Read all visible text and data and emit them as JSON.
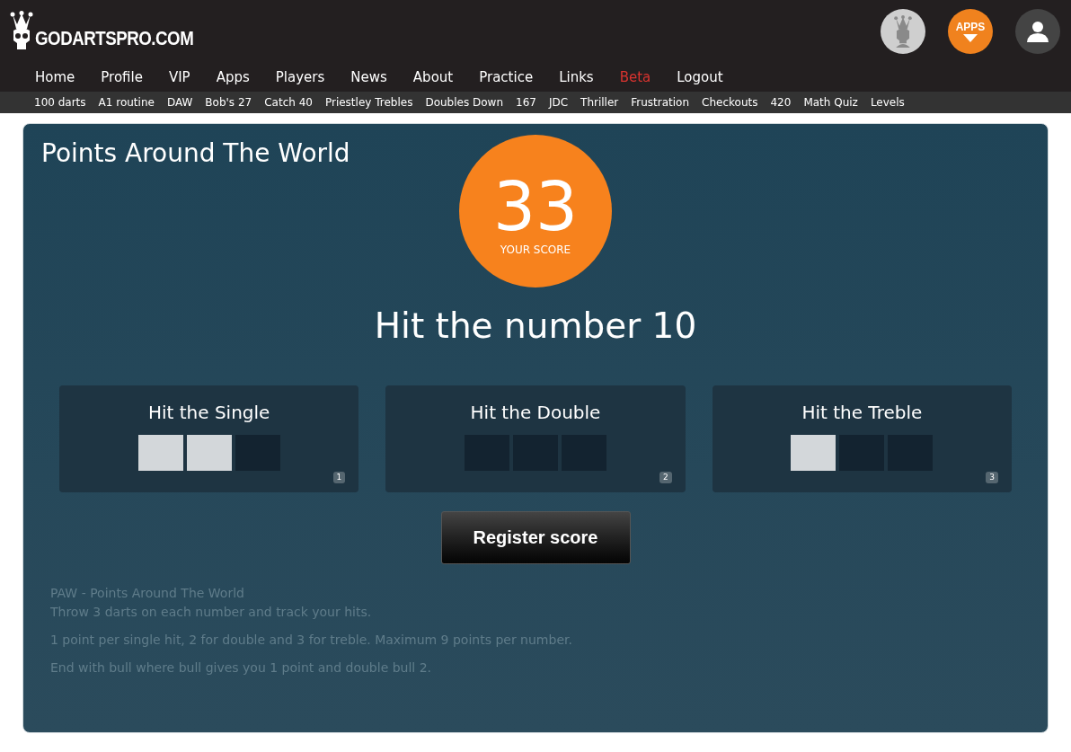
{
  "logo": {
    "text": "GODARTSPRO.COM"
  },
  "header_icons": {
    "apps_label": "APPS"
  },
  "nav": [
    {
      "label": "Home",
      "highlighted": false
    },
    {
      "label": "Profile",
      "highlighted": false
    },
    {
      "label": "VIP",
      "highlighted": false
    },
    {
      "label": "Apps",
      "highlighted": false
    },
    {
      "label": "Players",
      "highlighted": false
    },
    {
      "label": "News",
      "highlighted": false
    },
    {
      "label": "About",
      "highlighted": false
    },
    {
      "label": "Practice",
      "highlighted": false
    },
    {
      "label": "Links",
      "highlighted": false
    },
    {
      "label": "Beta",
      "highlighted": true
    },
    {
      "label": "Logout",
      "highlighted": false
    }
  ],
  "subnav": [
    "100 darts",
    "A1 routine",
    "DAW",
    "Bob's 27",
    "Catch 40",
    "Priestley Trebles",
    "Doubles Down",
    "167",
    "JDC",
    "Thriller",
    "Frustration",
    "Checkouts",
    "420",
    "Math Quiz",
    "Levels"
  ],
  "game": {
    "title": "Points Around The World",
    "score": "33",
    "score_label": "YOUR SCORE",
    "instruction": "Hit the number 10",
    "targets": [
      {
        "title": "Hit the Single",
        "key": "1",
        "darts": [
          {
            "hit": true
          },
          {
            "hit": true
          },
          {
            "hit": false
          }
        ]
      },
      {
        "title": "Hit the Double",
        "key": "2",
        "darts": [
          {
            "hit": false
          },
          {
            "hit": false
          },
          {
            "hit": false
          }
        ]
      },
      {
        "title": "Hit the Treble",
        "key": "3",
        "darts": [
          {
            "hit": true
          },
          {
            "hit": false
          },
          {
            "hit": false
          }
        ]
      }
    ],
    "button": "Register score",
    "description": [
      [
        "PAW - Points Around The World",
        "Throw 3 darts on each number and track your hits."
      ],
      [
        "1 point per single hit, 2 for double and 3 for treble. Maximum 9 points per number."
      ],
      [
        "End with bull where bull gives you 1 point and double bull 2."
      ]
    ]
  }
}
